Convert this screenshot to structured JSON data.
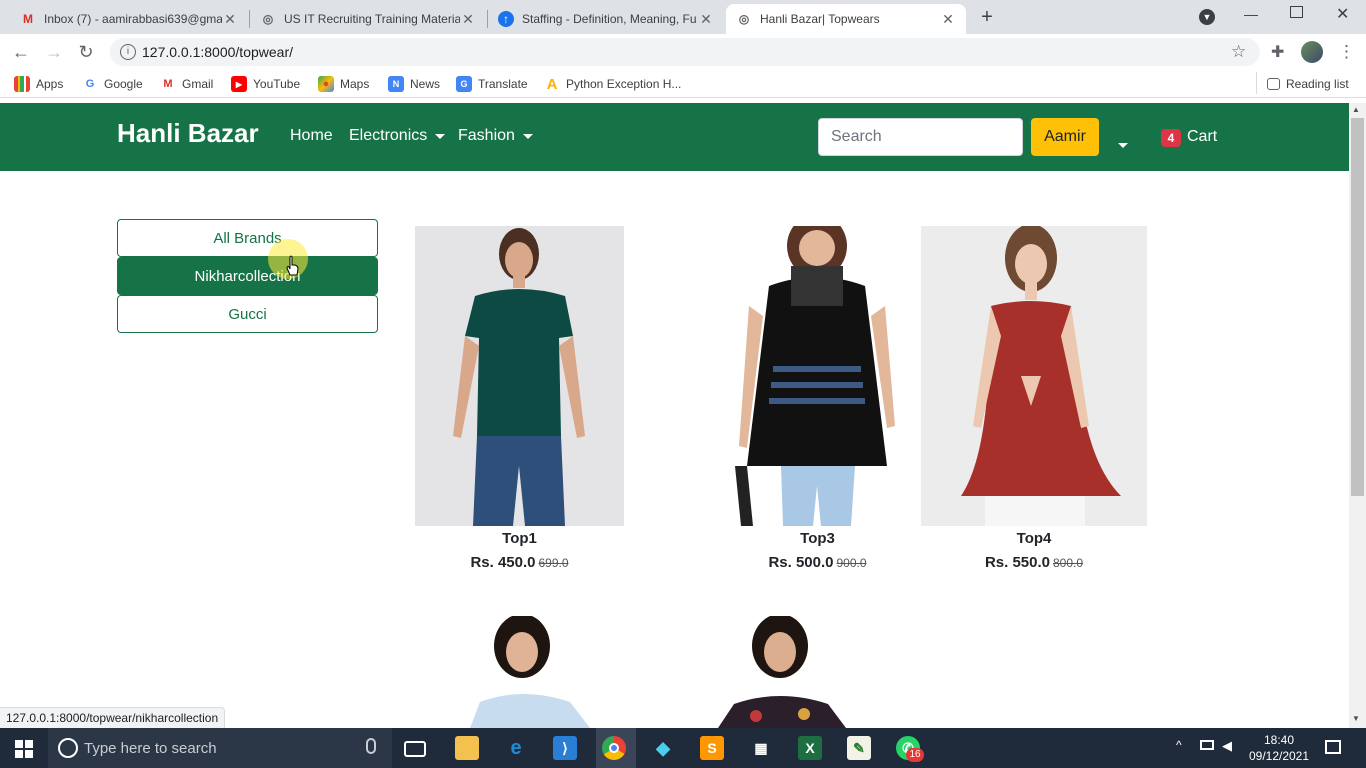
{
  "browser": {
    "tabs": [
      {
        "title": "Inbox (7) - aamirabbasi639@gma",
        "icon": "gmail-icon",
        "active": false
      },
      {
        "title": "US IT Recruiting Training Materia",
        "icon": "globe-icon",
        "active": false
      },
      {
        "title": "Staffing - Definition, Meaning, Fu",
        "icon": "staffing-icon",
        "active": false
      },
      {
        "title": "Hanli Bazar| Topwears",
        "icon": "globe-icon",
        "active": true
      }
    ],
    "url": "127.0.0.1:8000/topwear/",
    "bookmarks": [
      {
        "label": "Apps",
        "icon": "apps-grid-icon"
      },
      {
        "label": "Google",
        "icon": "google-icon"
      },
      {
        "label": "Gmail",
        "icon": "gmail-icon"
      },
      {
        "label": "YouTube",
        "icon": "youtube-icon"
      },
      {
        "label": "Maps",
        "icon": "maps-icon"
      },
      {
        "label": "News",
        "icon": "news-icon"
      },
      {
        "label": "Translate",
        "icon": "translate-icon"
      },
      {
        "label": "Python Exception H...",
        "icon": "bookmark-a-icon"
      }
    ],
    "reading_list": "Reading list",
    "status_url": "127.0.0.1:8000/topwear/nikharcollection"
  },
  "site": {
    "brand": "Hanli Bazar",
    "nav": {
      "home": "Home",
      "electronics": "Electronics",
      "fashion": "Fashion"
    },
    "search_placeholder": "Search",
    "user": "Aamir",
    "cart_count": "4",
    "cart_label": "Cart",
    "primary_color": "#157347",
    "accent_color": "#ffc107"
  },
  "filters": [
    {
      "label": "All Brands",
      "active": false
    },
    {
      "label": "Nikharcollection",
      "active": true
    },
    {
      "label": "Gucci",
      "active": false
    }
  ],
  "products": [
    {
      "name": "Top1",
      "price": "Rs. 450.0",
      "old_price": "699.0"
    },
    {
      "name": "Top3",
      "price": "Rs. 500.0",
      "old_price": "900.0"
    },
    {
      "name": "Top4",
      "price": "Rs. 550.0",
      "old_price": "800.0"
    }
  ],
  "taskbar": {
    "search_placeholder": "Type here to search",
    "time": "18:40",
    "date": "09/12/2021",
    "whatsapp_badge": "16"
  }
}
